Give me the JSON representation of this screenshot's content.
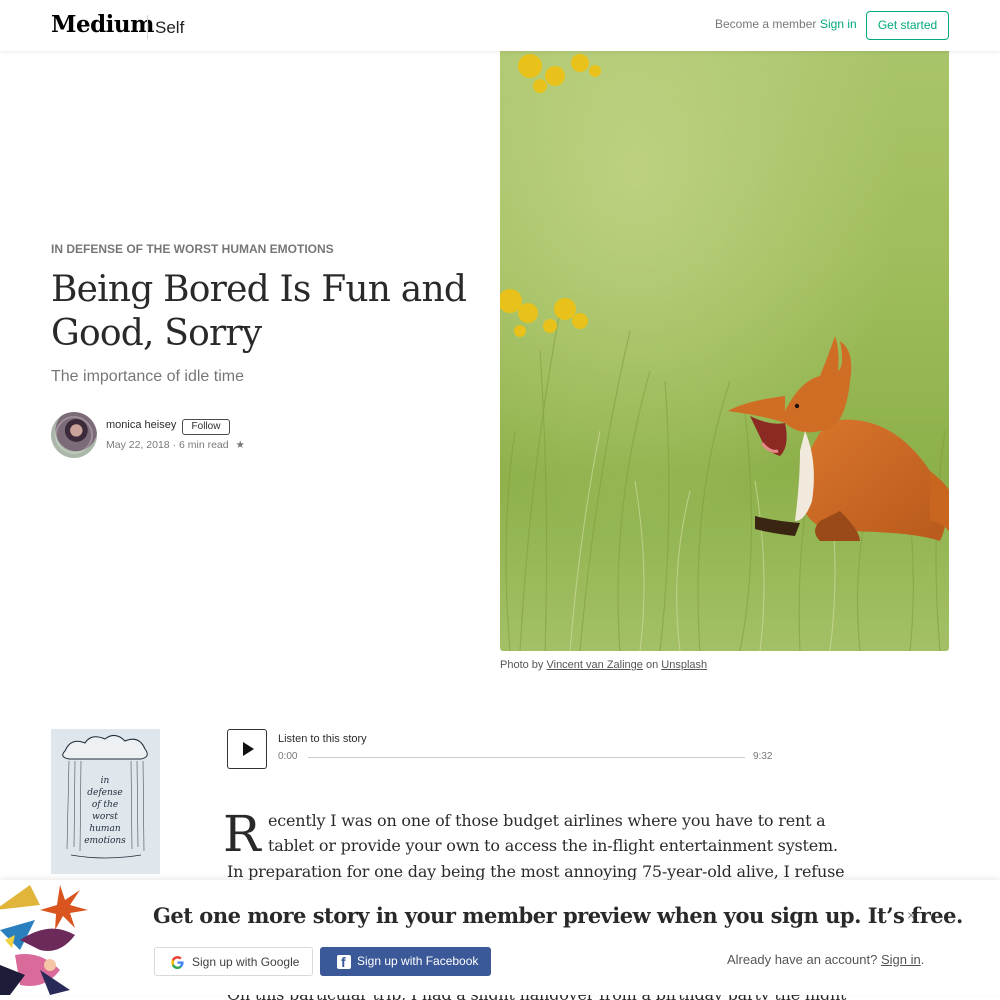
{
  "header": {
    "logo": "Medium",
    "publication": "Self",
    "become_member": "Become a member",
    "sign_in": "Sign in",
    "get_started": "Get started"
  },
  "article": {
    "kicker": "IN DEFENSE OF THE WORST HUMAN EMOTIONS",
    "title": "Being Bored Is Fun and Good, Sorry",
    "subtitle": "The importance of idle time",
    "author": "monica heisey",
    "follow": "Follow",
    "date": "May 22, 2018",
    "separator": "·",
    "read_time": "6 min read",
    "star": "★",
    "caption": {
      "prefix": "Photo by",
      "photographer": "Vincent van Zalinge",
      "on": "on",
      "source": "Unsplash"
    },
    "body": {
      "dropcap": "R",
      "line1": "ecently I was on one of those budget airlines where you have to rent a",
      "line2": "tablet or provide your own to access the in-flight entertainment system.",
      "line3": "In preparation for one day being the most annoying 75-year-old alive, I refuse",
      "line4": "On this particular trip, I had a slight hangover from a birthday party the night"
    }
  },
  "audio": {
    "label": "Listen to this story",
    "current_time": "0:00",
    "duration": "9:32",
    "progress": 0
  },
  "overlay": {
    "title": "Get one more story in your member preview when you sign up. It’s free.",
    "close": "×",
    "google": "Sign up with Google",
    "facebook": "Sign up with Facebook",
    "already": "Already have an account?",
    "sign_in": "Sign in",
    "period": "."
  },
  "colors": {
    "accent": "#03a87c",
    "facebook": "#3b5998"
  },
  "icons": {
    "play": "play-icon",
    "close": "close-icon",
    "google": "google-icon",
    "facebook": "facebook-icon",
    "star": "star-icon"
  }
}
